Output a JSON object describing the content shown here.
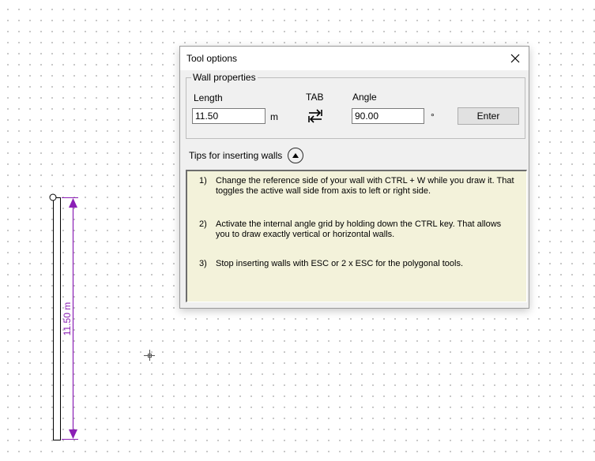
{
  "dialog": {
    "title": "Tool options",
    "close_icon": "close-icon",
    "wall_properties": {
      "legend": "Wall properties",
      "length_label": "Length",
      "length_value": "11.50",
      "length_unit": "m",
      "tab_label": "TAB",
      "tab_icon": "swap-arrows-icon",
      "angle_label": "Angle",
      "angle_value": "90.00",
      "angle_unit": "°",
      "enter_label": "Enter"
    },
    "tips": {
      "header": "Tips for inserting walls",
      "collapse_icon": "chevron-up-icon",
      "items": [
        {
          "num": "1)",
          "text": "Change the reference side of your wall with CTRL + W while you draw it. That toggles the active wall side from axis to left or right side."
        },
        {
          "num": "2)",
          "text": "Activate the internal angle grid by holding down the CTRL key. That allows you to draw exactly vertical or horizontal walls."
        },
        {
          "num": "3)",
          "text": "Stop inserting walls with ESC or 2 x ESC for the polygonal tools."
        }
      ]
    }
  },
  "drawing": {
    "dimension_label": "11.50 m",
    "dimension_color": "#8b1fb5"
  }
}
